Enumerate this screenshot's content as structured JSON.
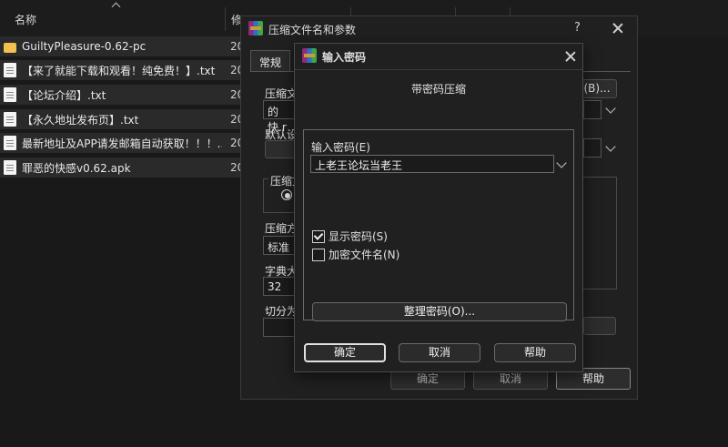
{
  "explorer": {
    "columns": {
      "name": "名称",
      "modified": "修",
      "c3": "",
      "c4": ""
    },
    "files": [
      {
        "name": "GuiltyPleasure-0.62-pc",
        "date": "20",
        "type": "folder"
      },
      {
        "name": "【来了就能下载和观看！纯免费！】.txt",
        "date": "20",
        "type": "txt"
      },
      {
        "name": "【论坛介绍】.txt",
        "date": "20",
        "type": "txt"
      },
      {
        "name": "【永久地址发布页】.txt",
        "date": "20",
        "type": "txt"
      },
      {
        "name": "最新地址及APP请发邮箱自动获取！！！....",
        "date": "20",
        "type": "txt"
      },
      {
        "name": "罪恶的快感v0.62.apk",
        "date": "20",
        "type": "apk"
      }
    ]
  },
  "archive_dialog": {
    "title": "压缩文件名和参数",
    "help_q": "?",
    "tab_general": "常规",
    "archive_name_label": "压缩文",
    "archive_name_value": "的快.r",
    "browse_label": "(B)...",
    "default_label": "默认设",
    "format_group": "压缩文",
    "method_label": "压缩方",
    "method_value": "标准",
    "dict_label": "字典大",
    "dict_value": "32",
    "split_label": "切分为",
    "ok": "确定",
    "cancel": "取消",
    "help": "帮助"
  },
  "password_dialog": {
    "title": "输入密码",
    "heading": "带密码压缩",
    "password_label": "输入密码(E)",
    "password_value": "上老王论坛当老王",
    "show_password": {
      "label": "显示密码(S)",
      "checked": true
    },
    "encrypt_names": {
      "label": "加密文件名(N)",
      "checked": false
    },
    "organize_button": "整理密码(O)...",
    "ok": "确定",
    "cancel": "取消",
    "help": "帮助"
  }
}
